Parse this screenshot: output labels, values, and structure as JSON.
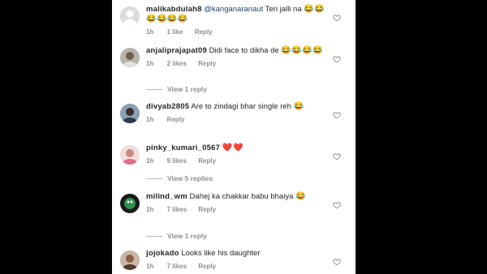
{
  "comments": [
    {
      "username": "malikabdulah8",
      "mention": "@kanganaranaut",
      "text": "Teri jalli na",
      "emojis": "😂😂😂😂😂😂",
      "time": "1h",
      "likes": "1 like",
      "reply": "Reply"
    },
    {
      "username": "anjaliprajapat09",
      "text": "Didi face to dikha de",
      "emojis": "😂😂😂😂",
      "time": "1h",
      "likes": "2 likes",
      "reply": "Reply",
      "view_replies": "View 1 reply"
    },
    {
      "username": "divyab2805",
      "text": "Are to zindagi bhar single reh",
      "emojis": "😂",
      "time": "1h",
      "reply": "Reply"
    },
    {
      "username": "pinky_kumari_0567",
      "text": "",
      "emojis": "❤️❤️",
      "time": "1h",
      "likes": "9 likes",
      "reply": "Reply",
      "view_replies": "View 5 replies"
    },
    {
      "username": "milind_wm",
      "text": "Dahej ka chakkar babu bhaiya",
      "emojis": "😂",
      "time": "1h",
      "likes": "7 likes",
      "reply": "Reply",
      "view_replies": "View 1 reply"
    },
    {
      "username": "jojokado",
      "text": "Looks like his daughter",
      "time": "1h",
      "likes": "7 likes",
      "reply": "Reply"
    }
  ],
  "icons": {
    "like": "heart-outline-icon"
  }
}
